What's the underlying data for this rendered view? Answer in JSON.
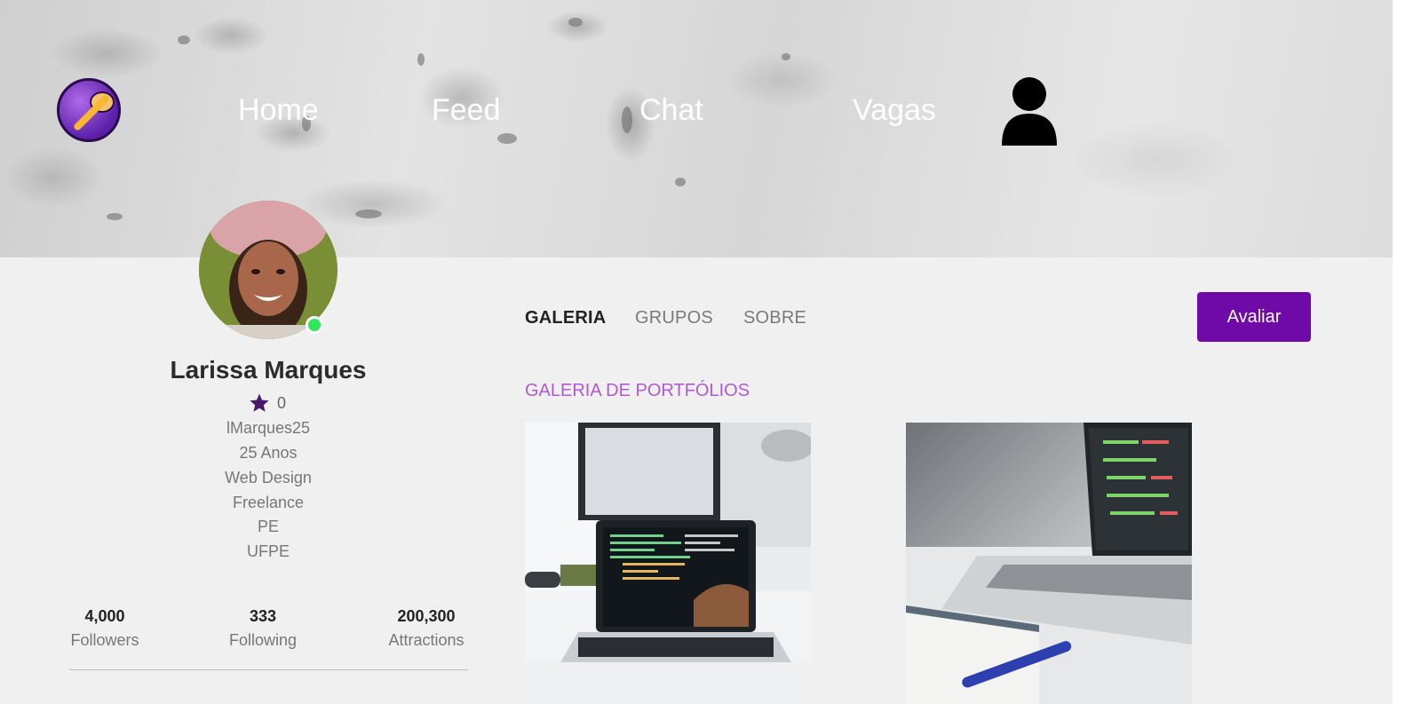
{
  "nav": {
    "links": [
      "Home",
      "Feed",
      "Chat",
      "Vagas"
    ],
    "logo_icon": "palette-brush-logo-icon",
    "profile_icon": "user-icon"
  },
  "profile": {
    "name": "Larissa Marques",
    "rating": "0",
    "rating_icon": "star-icon",
    "username": "lMarques25",
    "age": "25 Anos",
    "area": "Web Design",
    "work": "Freelance",
    "state": "PE",
    "university": "UFPE",
    "online": true,
    "status_color": "#2ee85c"
  },
  "stats": [
    {
      "value": "4,000",
      "label": "Followers"
    },
    {
      "value": "333",
      "label": "Following"
    },
    {
      "value": "200,300",
      "label": "Attractions"
    }
  ],
  "tabs": [
    {
      "label": "GALERIA",
      "active": true
    },
    {
      "label": "GRUPOS",
      "active": false
    },
    {
      "label": "SOBRE",
      "active": false
    }
  ],
  "actions": {
    "avaliar_label": "Avaliar"
  },
  "gallery": {
    "title": "GALERIA DE PORTFÓLIOS",
    "items": [
      "laptop-desk-photo",
      "laptop-notebook-photo"
    ]
  },
  "colors": {
    "accent": "#6f0aa8",
    "section_title": "#b05ad0",
    "background": "#f0f0f0"
  }
}
